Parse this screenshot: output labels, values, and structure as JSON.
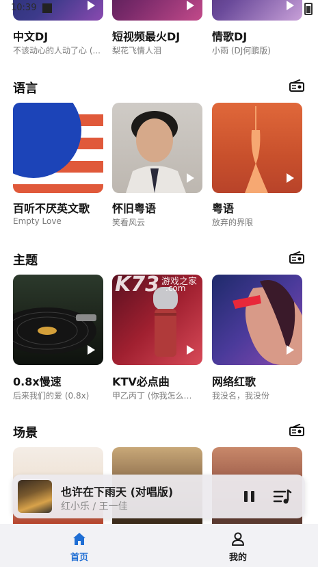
{
  "status_bar": {
    "time": "10:39"
  },
  "top_row": [
    {
      "title": "中文DJ",
      "subtitle": "不该动心的人动了心 (..."
    },
    {
      "title": "短视频最火DJ",
      "subtitle": "梨花飞情人泪"
    },
    {
      "title": "情歌DJ",
      "subtitle": "小雨 (DJ何鹏版)"
    }
  ],
  "sections": [
    {
      "title": "语言",
      "cards": [
        {
          "title": "百听不厌英文歌",
          "subtitle": "Empty Love"
        },
        {
          "title": "怀旧粤语",
          "subtitle": "笑看风云"
        },
        {
          "title": "粤语",
          "subtitle": "放弃的界限"
        }
      ]
    },
    {
      "title": "主题",
      "cards": [
        {
          "title": "0.8x慢速",
          "subtitle": "后来我们的爱 (0.8x)"
        },
        {
          "title": "KTV必点曲",
          "subtitle": "甲乙丙丁 (你我怎么…"
        },
        {
          "title": "网络红歌",
          "subtitle": "我没名，我没份"
        }
      ]
    },
    {
      "title": "场景"
    }
  ],
  "watermark": {
    "main": "K73",
    "cn": "游戏之家",
    "dom": ".com"
  },
  "now_playing": {
    "title": "也许在下雨天 (对唱版)",
    "artist": "红小乐 / 王一佳"
  },
  "nav": [
    {
      "label": "首页",
      "active": true
    },
    {
      "label": "我的",
      "active": false
    }
  ],
  "colors": {
    "accent": "#1f6ed4",
    "nav_bg": "#f2f2f5"
  }
}
